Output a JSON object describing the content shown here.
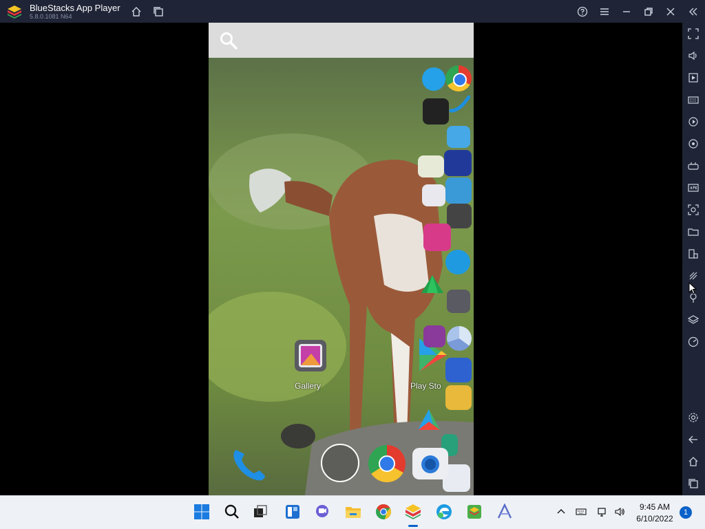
{
  "window": {
    "title": "BlueStacks App Player",
    "version": "5.8.0.1081 N64"
  },
  "titlebar_buttons": [
    "home-icon",
    "multi-instance-icon",
    "help-icon",
    "menu-icon",
    "minimize-icon",
    "maximize-icon",
    "close-icon",
    "collapse-sidebar-icon"
  ],
  "sidebar": {
    "top_items": [
      "fullscreen-icon",
      "volume-icon",
      "media-icon",
      "keyboard-icon",
      "macro-icon",
      "rotate-icon",
      "gamepad-icon",
      "apk-icon",
      "screenshot-icon",
      "folder-icon",
      "multi-screen-icon",
      "eco-mode-icon",
      "location-icon",
      "layers-icon",
      "performance-icon"
    ],
    "bottom_items": [
      "settings-icon",
      "back-icon",
      "android-home-icon",
      "recent-apps-icon"
    ]
  },
  "android": {
    "search_icon": "search-icon",
    "home_apps": [
      {
        "label": "Gallery",
        "icon": "gallery-icon"
      },
      {
        "label": "Play Sto",
        "icon": "play-store-icon"
      }
    ],
    "dock": [
      "phone-icon",
      "app-drawer-icon",
      "chrome-icon",
      "camera-icon"
    ],
    "side_apps": [
      "dialer-icon",
      "chrome-icon",
      "puzzle-game-icon",
      "phone-icon",
      "home-x-icon",
      "calendar-icon",
      "gems-game-icon",
      "camera-app-icon",
      "blocks-game-icon",
      "cracked-screen-icon",
      "balls-game-icon",
      "share-icon",
      "gem-icon",
      "gallery-icon",
      "game-icon",
      "pie-chart-icon",
      "play-store-icon",
      "cards-icon",
      "jigsaw-icon",
      "play-store-small-icon",
      "calculator-icon",
      "unknown-app-icon"
    ]
  },
  "taskbar": {
    "apps": [
      "windows-start-icon",
      "search-icon",
      "task-view-icon",
      "widgets-icon",
      "teams-chat-icon",
      "file-explorer-icon",
      "chrome-icon",
      "bluestacks-icon",
      "edge-icon",
      "multi-instance-manager-icon",
      "arc-icon"
    ],
    "tray": [
      "chevron-up-icon",
      "keyboard-icon",
      "network-icon",
      "volume-icon"
    ],
    "time": "9:45 AM",
    "date": "6/10/2022",
    "notification_count": "1"
  },
  "colors": {
    "titlebar_bg": "#1f2436",
    "taskbar_bg": "#eef1f6",
    "accent": "#0a62c9"
  }
}
